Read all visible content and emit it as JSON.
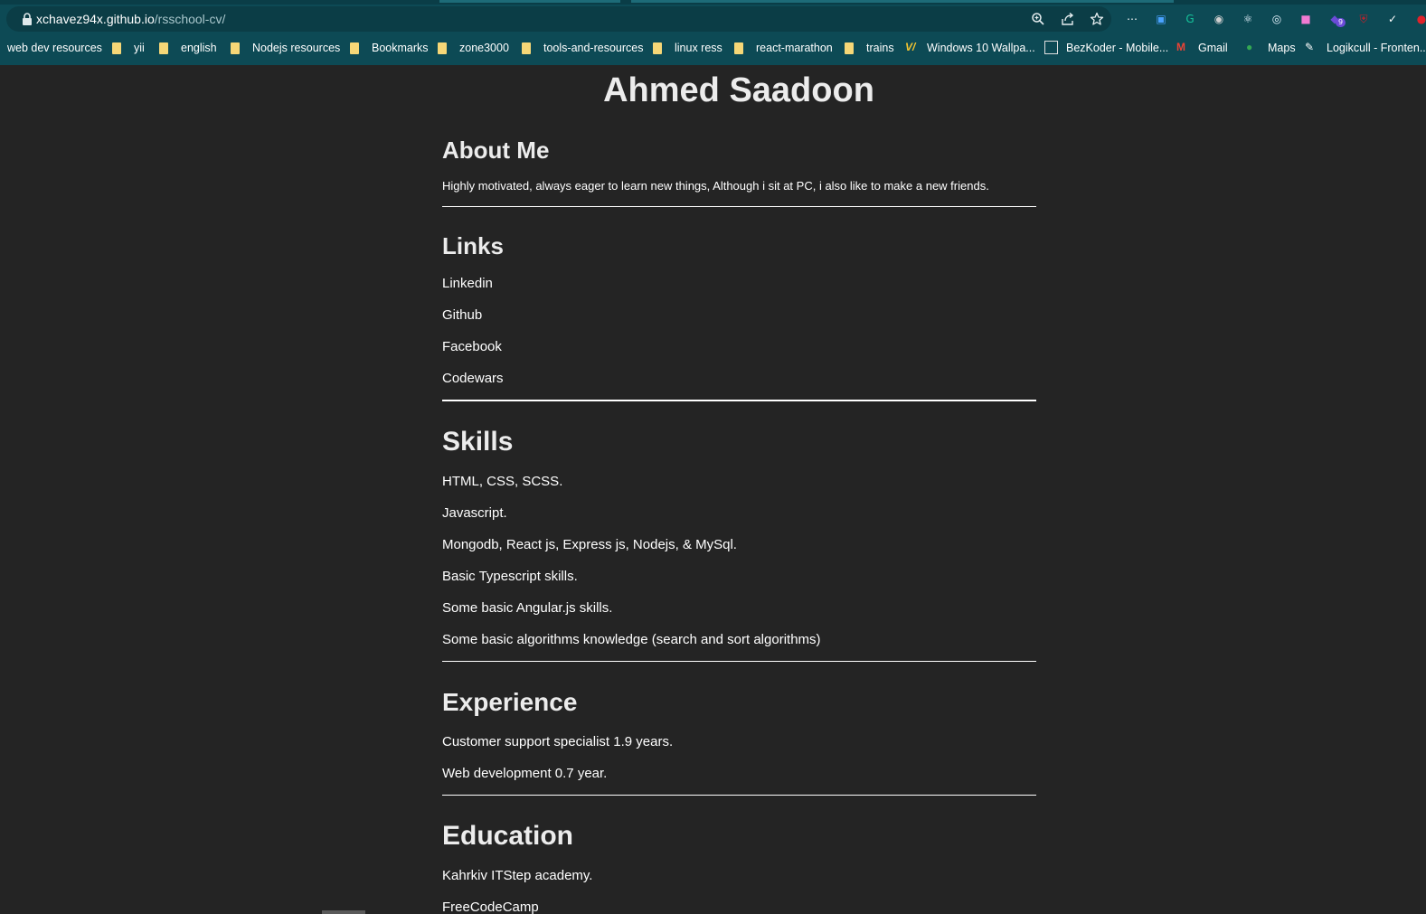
{
  "browser": {
    "url_host": "xchavez94x.github.io",
    "url_path": "/rsschool-cv/",
    "address_icons": [
      "zoom-icon",
      "share-icon",
      "star-icon"
    ],
    "extensions": [
      {
        "name": "more-extensions-icon",
        "glyph": "⋯",
        "color": "#ffffff"
      },
      {
        "name": "screen-capture-extension-icon",
        "glyph": "▣",
        "color": "#4aa3ff"
      },
      {
        "name": "grammarly-extension-icon",
        "glyph": "G",
        "color": "#15c39a"
      },
      {
        "name": "camera-extension-icon",
        "glyph": "◉",
        "color": "#d0d0d0"
      },
      {
        "name": "react-devtools-extension-icon",
        "glyph": "⚛",
        "color": "#e8f4ff"
      },
      {
        "name": "target-extension-icon",
        "glyph": "◎",
        "color": "#e8f4ff"
      },
      {
        "name": "gradient-extension-icon",
        "glyph": "■",
        "color": "#f07bd3"
      },
      {
        "name": "redux-extension-icon",
        "glyph": "◆",
        "color": "#6b4bd8"
      },
      {
        "name": "ublock-extension-icon",
        "glyph": "⛨",
        "color": "#c0212c"
      },
      {
        "name": "check-extension-icon",
        "glyph": "✓",
        "color": "#ffffff"
      },
      {
        "name": "red-extension-icon",
        "glyph": "●",
        "color": "#e0222a"
      }
    ],
    "extension_badge": "9",
    "bookmarks": [
      {
        "label": "web dev resources",
        "type": "text"
      },
      {
        "label": "yii",
        "type": "folder"
      },
      {
        "label": "english",
        "type": "folder"
      },
      {
        "label": "Nodejs resources",
        "type": "folder"
      },
      {
        "label": "Bookmarks",
        "type": "folder"
      },
      {
        "label": "zone3000",
        "type": "folder"
      },
      {
        "label": "tools-and-resources",
        "type": "folder"
      },
      {
        "label": "linux ress",
        "type": "folder"
      },
      {
        "label": "react-marathon",
        "type": "folder"
      },
      {
        "label": "trains",
        "type": "folder"
      },
      {
        "label": "Windows 10 Wallpa...",
        "type": "site",
        "icon": "wallpaper-site-icon"
      },
      {
        "label": "BezKoder - Mobile...",
        "type": "site",
        "icon": "bezkoder-site-icon"
      },
      {
        "label": "Gmail",
        "type": "site",
        "icon": "gmail-icon"
      },
      {
        "label": "Maps",
        "type": "site",
        "icon": "maps-icon"
      },
      {
        "label": "Logikcull - Fronten...",
        "type": "site",
        "icon": "logikcull-site-icon"
      }
    ]
  },
  "cv": {
    "name": "Ahmed Saadoon",
    "about": {
      "heading": "About Me",
      "text": "Highly motivated, always eager to learn new things, Although i sit at PC, i also like to make a new friends."
    },
    "links": {
      "heading": "Links",
      "items": [
        "Linkedin",
        "Github",
        "Facebook",
        "Codewars"
      ]
    },
    "skills": {
      "heading": "Skills",
      "items": [
        "HTML, CSS, SCSS.",
        "Javascript.",
        "Mongodb, React js, Express js, Nodejs, & MySql.",
        "Basic Typescript skills.",
        "Some basic Angular.js skills.",
        "Some basic algorithms knowledge (search and sort algorithms)"
      ]
    },
    "experience": {
      "heading": "Experience",
      "items": [
        "Customer support specialist 1.9 years.",
        "Web development 0.7 year."
      ]
    },
    "education": {
      "heading": "Education",
      "items": [
        "Kahrkiv ITStep academy.",
        "FreeCodeCamp"
      ]
    }
  },
  "colors": {
    "page_background": "#242424",
    "browser_chrome": "#0d4a55",
    "text": "#ececec",
    "folder": "#f6d777"
  }
}
